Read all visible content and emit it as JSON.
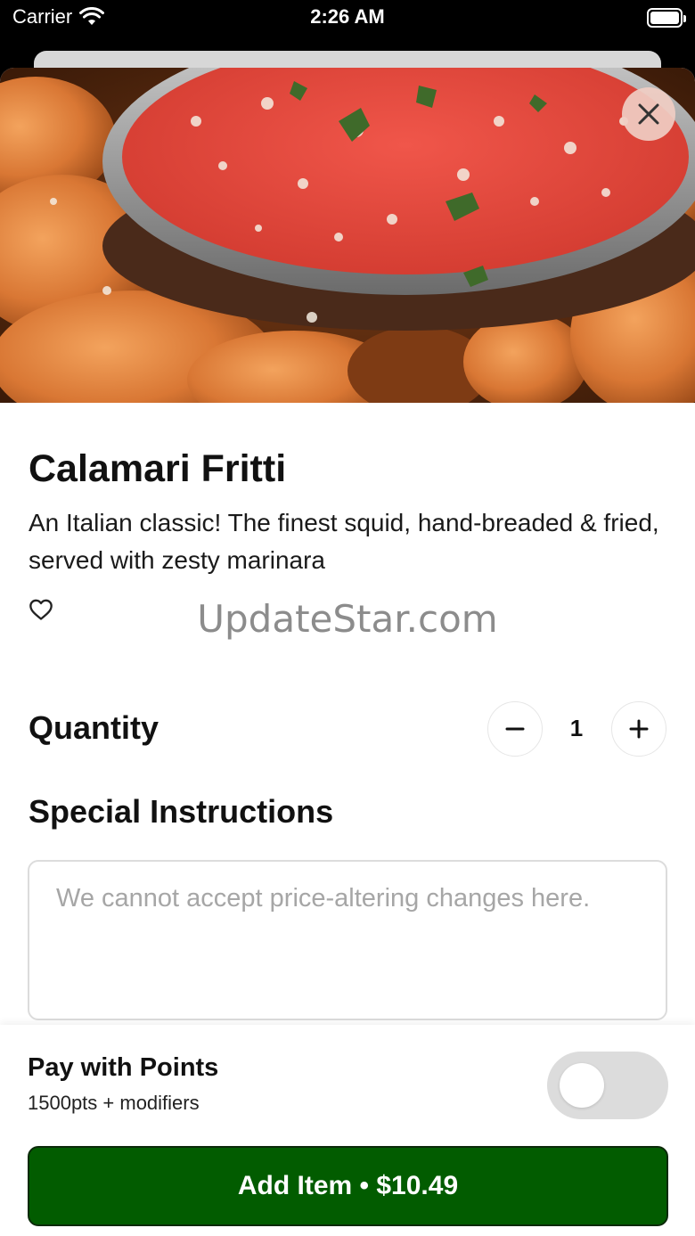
{
  "status_bar": {
    "carrier": "Carrier",
    "time": "2:26 AM",
    "wifi_icon": "wifi-icon",
    "battery_icon": "battery-icon"
  },
  "item": {
    "image_alt": "calamari-with-marinara",
    "title": "Calamari Fritti",
    "description": "An Italian classic! The finest squid, hand-breaded & fried, served with zesty marinara",
    "favorite_icon": "heart-outline-icon",
    "close_icon": "close-icon"
  },
  "watermark": "UpdateStar.com",
  "quantity": {
    "label": "Quantity",
    "value": "1",
    "minus_icon": "minus-icon",
    "plus_icon": "plus-icon"
  },
  "special_instructions": {
    "label": "Special Instructions",
    "placeholder": "We cannot accept price-altering changes here.",
    "value": ""
  },
  "pay_with_points": {
    "label": "Pay with Points",
    "sublabel": "1500pts + modifiers",
    "enabled": false
  },
  "add_button": {
    "label": "Add Item • $10.49"
  },
  "colors": {
    "primary_button": "#025c00",
    "toggle_off": "#dcdcdc",
    "close_button_bg": "#f0cdc3"
  }
}
